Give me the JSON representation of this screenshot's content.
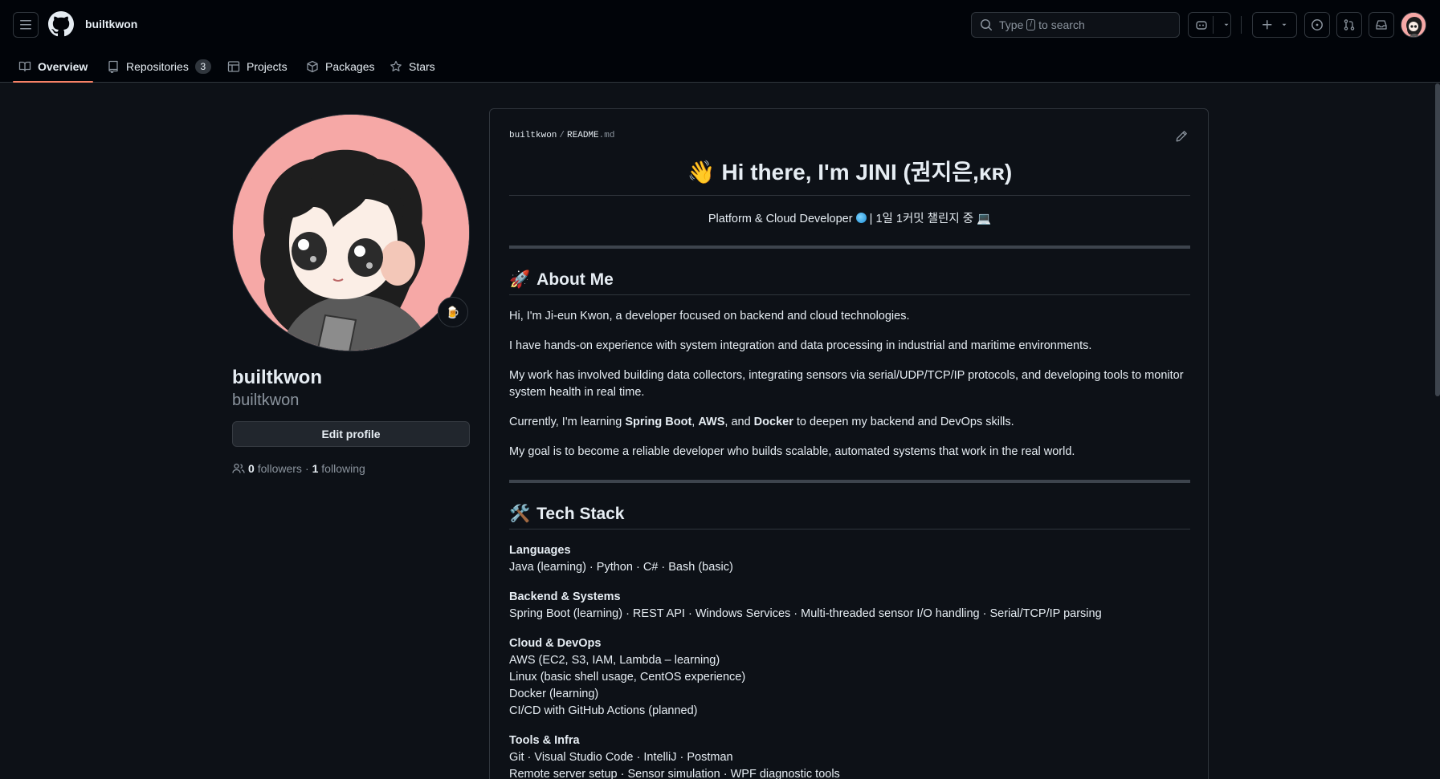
{
  "header": {
    "context_label": "builtkwon",
    "search_prefix": "Type",
    "search_key": "/",
    "search_suffix": "to search"
  },
  "tabs": [
    {
      "label": "Overview",
      "selected": true
    },
    {
      "label": "Repositories",
      "count": "3"
    },
    {
      "label": "Projects"
    },
    {
      "label": "Packages"
    },
    {
      "label": "Stars"
    }
  ],
  "profile": {
    "name": "builtkwon",
    "login": "builtkwon",
    "status_emoji": "🍺",
    "edit_label": "Edit profile",
    "followers_count": "0",
    "followers_label": "followers",
    "dot": "·",
    "following_count": "1",
    "following_label": "following"
  },
  "readme": {
    "crumb_owner": "builtkwon",
    "crumb_sep": "/",
    "crumb_file": "README",
    "crumb_ext": ".md",
    "title": "👋 Hi there, I'm JINI (권지은,ᴋʀ)",
    "tagline_a": "Platform & Cloud Developer",
    "tagline_b": "| 1일 1커밋 챌린지 중 💻",
    "about_emoji": "🚀",
    "about_heading": "About Me",
    "about_p1": "Hi, I'm Ji-eun Kwon, a developer focused on backend and cloud technologies.",
    "about_p2": "I have hands-on experience with system integration and data processing in industrial and maritime environments.",
    "about_p3": "My work has involved building data collectors, integrating sensors via serial/UDP/TCP/IP protocols, and developing tools to monitor system health in real time.",
    "about_p4_a": "Currently, I'm learning ",
    "about_p4_b1": "Spring Boot",
    "about_p4_c1": ", ",
    "about_p4_b2": "AWS",
    "about_p4_c2": ", and ",
    "about_p4_b3": "Docker",
    "about_p4_d": " to deepen my backend and DevOps skills.",
    "about_p5": "My goal is to become a reliable developer who builds scalable, automated systems that work in the real world.",
    "tech_emoji": "🛠️",
    "tech_heading": "Tech Stack",
    "stack": [
      {
        "title": "Languages",
        "lines": [
          "Java (learning) · Python · C# · Bash (basic)"
        ]
      },
      {
        "title": "Backend & Systems",
        "lines": [
          "Spring Boot (learning) · REST API · Windows Services · Multi-threaded sensor I/O handling · Serial/TCP/IP parsing"
        ]
      },
      {
        "title": "Cloud & DevOps",
        "lines": [
          "AWS (EC2, S3, IAM, Lambda – learning)",
          "Linux (basic shell usage, CentOS experience)",
          "Docker (learning)",
          "CI/CD with GitHub Actions (planned)"
        ]
      },
      {
        "title": "Tools & Infra",
        "lines": [
          "Git · Visual Studio Code · IntelliJ · Postman",
          "Remote server setup · Sensor simulation · WPF diagnostic tools"
        ]
      }
    ]
  },
  "colors": {
    "background": "#0d1117",
    "header_bg": "#010409",
    "border": "#30363d",
    "accent_underline": "#f78166",
    "muted_text": "#8b949e",
    "avatar_bg": "#f6a8a6"
  }
}
